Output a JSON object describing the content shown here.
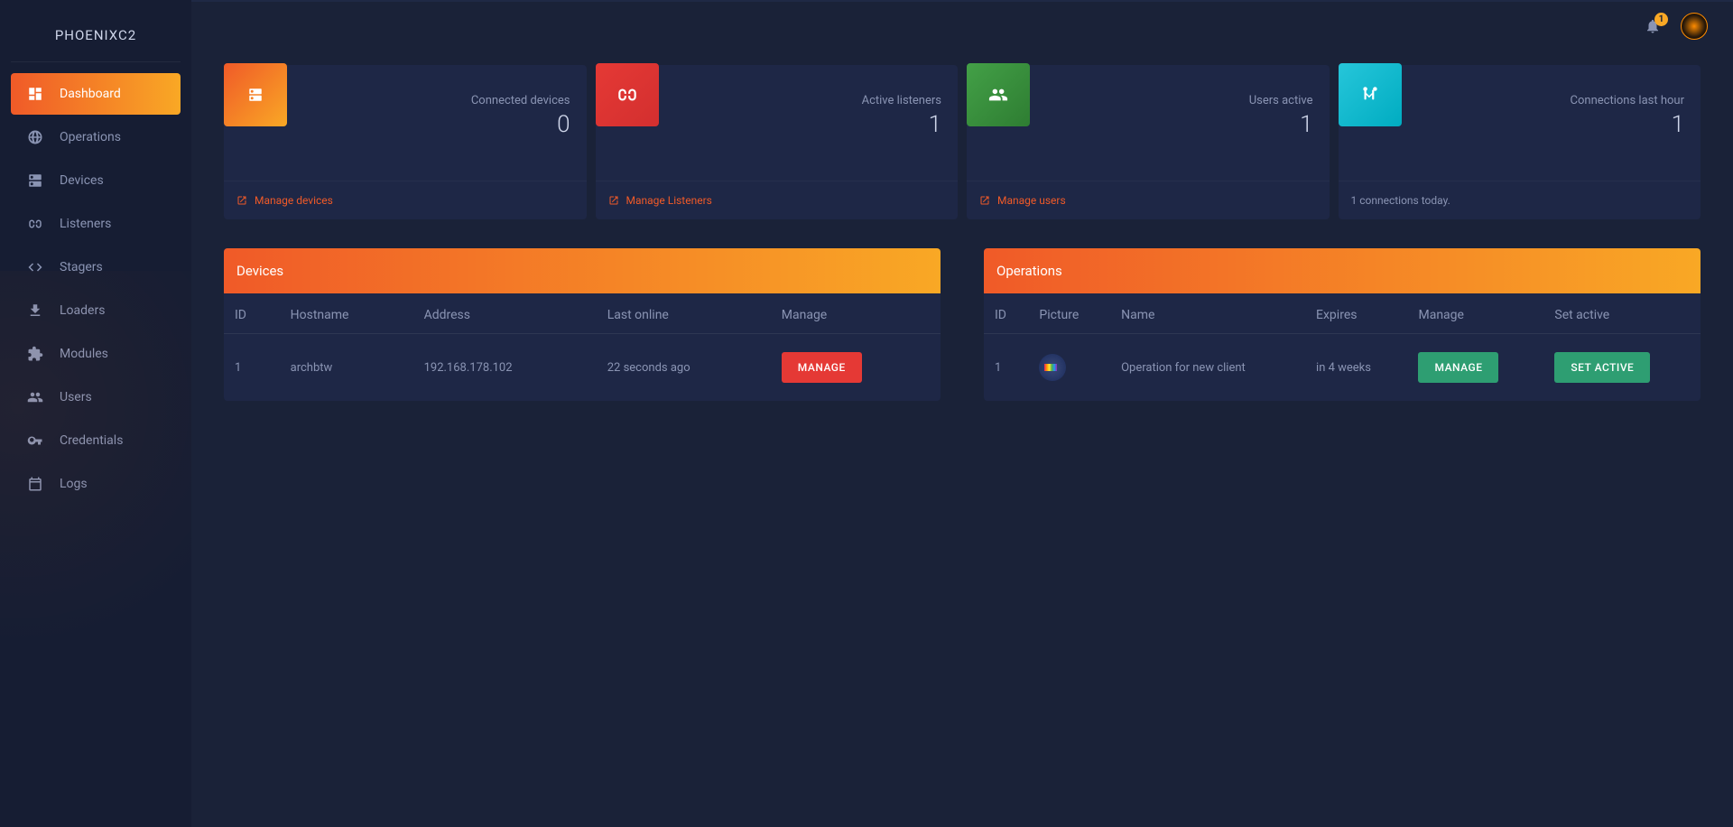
{
  "brand": "PHOENIXC2",
  "topbar": {
    "badge": "1"
  },
  "nav": [
    {
      "label": "Dashboard",
      "icon": "dashboard",
      "active": true
    },
    {
      "label": "Operations",
      "icon": "globe",
      "active": false
    },
    {
      "label": "Devices",
      "icon": "dns",
      "active": false
    },
    {
      "label": "Listeners",
      "icon": "listener",
      "active": false
    },
    {
      "label": "Stagers",
      "icon": "code",
      "active": false
    },
    {
      "label": "Loaders",
      "icon": "download",
      "active": false
    },
    {
      "label": "Modules",
      "icon": "extension",
      "active": false
    },
    {
      "label": "Users",
      "icon": "users",
      "active": false
    },
    {
      "label": "Credentials",
      "icon": "key",
      "active": false
    },
    {
      "label": "Logs",
      "icon": "calendar",
      "active": false
    }
  ],
  "stats": [
    {
      "label": "Connected devices",
      "value": "0",
      "color": "orange",
      "icon": "dns",
      "footer_type": "link",
      "footer": "Manage devices"
    },
    {
      "label": "Active listeners",
      "value": "1",
      "color": "red",
      "icon": "listener",
      "footer_type": "link",
      "footer": "Manage Listeners"
    },
    {
      "label": "Users active",
      "value": "1",
      "color": "green",
      "icon": "users",
      "footer_type": "link",
      "footer": "Manage users"
    },
    {
      "label": "Connections last hour",
      "value": "1",
      "color": "cyan",
      "icon": "connections",
      "footer_type": "text",
      "footer": "1 connections today."
    }
  ],
  "devices_panel": {
    "title": "Devices",
    "headers": [
      "ID",
      "Hostname",
      "Address",
      "Last online",
      "Manage"
    ],
    "rows": [
      {
        "id": "1",
        "hostname": "archbtw",
        "address": "192.168.178.102",
        "lastonline": "22 seconds ago",
        "manage": "MANAGE"
      }
    ]
  },
  "operations_panel": {
    "title": "Operations",
    "headers": [
      "ID",
      "Picture",
      "Name",
      "Expires",
      "Manage",
      "Set active"
    ],
    "rows": [
      {
        "id": "1",
        "name": "Operation for new client",
        "expires": "in 4 weeks",
        "manage": "MANAGE",
        "setactive": "SET ACTIVE"
      }
    ]
  }
}
